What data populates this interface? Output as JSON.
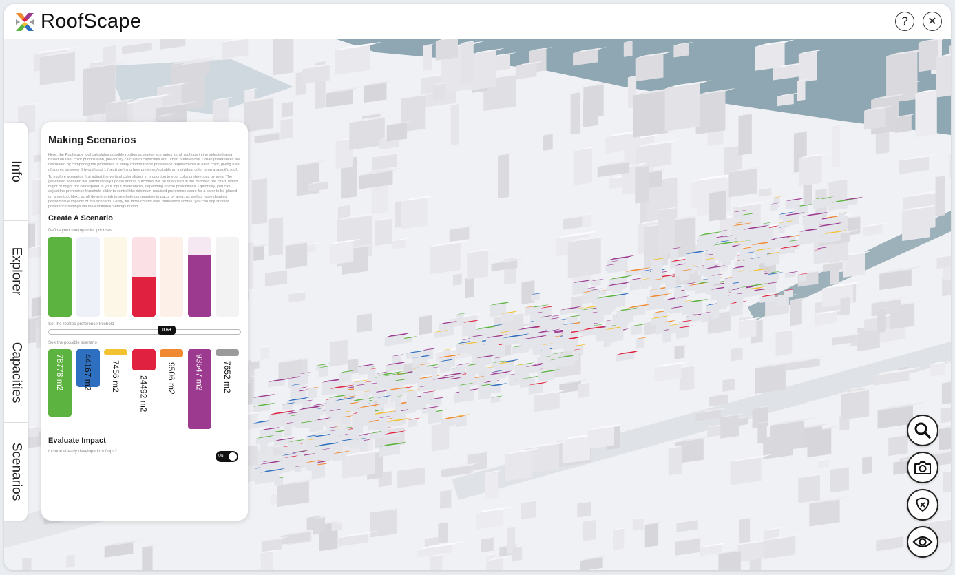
{
  "app": {
    "title": "RoofScape"
  },
  "header": {
    "help_label": "?",
    "close_label": "✕"
  },
  "tabs": [
    {
      "label": "Info"
    },
    {
      "label": "Explorer"
    },
    {
      "label": "Capacities"
    },
    {
      "label": "Scenarios"
    }
  ],
  "panel": {
    "title": "Making Scenarios",
    "desc1": "Here, the Roofscape tool calculates possible rooftop activation scenarios for all rooftops in the selected area based on user color prioritisation, previously calculated capacities and urban preferences. Urban preferences are calculated by comparing the properties of every rooftop to the preference requirements of each color, giving a set of scores between 0 (worst) and 1 (best) defining how preferred/suitable an individual color is on a specific roof.",
    "desc2": "To explore scenarios first adjust the vertical color sliders in proportion to your color preferences by area. The generated scenario will automatically update and its outcomes will be quantified in the mirrored bar chart, which might or might not correspond to your input preferences, depending on the possibilities. Optionally, you can adjust the preference threshold slider to control the minimum required preference score for a color to be placed on a rooftop. Next, scroll down the tab to see both comparative impacts by area, as well as more detailed performative impacts of this scenario. Lastly, for more control over preference scores, you can adjust color preference settings via the Additional Settings button.",
    "create_title": "Create A Scenario",
    "priorities_label": "Define your rooftop color priorities",
    "threshold_label": "Set the rooftop preference treshold",
    "threshold_value": "0.63",
    "scenario_label": "See the possible scenario",
    "evaluate_title": "Evaluate Impact",
    "include_label": "Include already developed rooftops?",
    "toggle_label": "ON"
  },
  "sliders": [
    {
      "color": "#5db33f",
      "track": "#5db33f",
      "level": 1.0
    },
    {
      "color": "#2f6fc0",
      "track": "#eef1f8",
      "level": 0.0
    },
    {
      "color": "#f2c230",
      "track": "#fdf7e8",
      "level": 0.0
    },
    {
      "color": "#e0213f",
      "track": "#fbe0e5",
      "level": 0.5
    },
    {
      "color": "#f08a30",
      "track": "#fdf0e8",
      "level": 0.0
    },
    {
      "color": "#9b3a8f",
      "track": "#f5e8f3",
      "level": 0.77
    },
    {
      "color": "#9a9a9a",
      "track": "#f3f3f4",
      "level": 0.0
    }
  ],
  "scenario": [
    {
      "label": "78778 m2",
      "color": "#5db33f",
      "text_color": "#ffffff",
      "value": 78778
    },
    {
      "label": "44167 m2",
      "color": "#2f6fc0",
      "text_color": "#111111",
      "value": 44167
    },
    {
      "label": "7456 m2",
      "color": "#f2c230",
      "text_color": "#111111",
      "value": 7456
    },
    {
      "label": "24492 m2",
      "color": "#e0213f",
      "text_color": "#111111",
      "value": 24492
    },
    {
      "label": "9506 m2",
      "color": "#f08a30",
      "text_color": "#111111",
      "value": 9506
    },
    {
      "label": "93547 m2",
      "color": "#9b3a8f",
      "text_color": "#ffffff",
      "value": 93547
    },
    {
      "label": "7652 m2",
      "color": "#9a9a9a",
      "text_color": "#111111",
      "value": 7652
    }
  ],
  "tools": [
    {
      "name": "search-icon"
    },
    {
      "name": "camera-icon"
    },
    {
      "name": "map-pin-off-icon"
    },
    {
      "name": "eye-icon"
    }
  ]
}
